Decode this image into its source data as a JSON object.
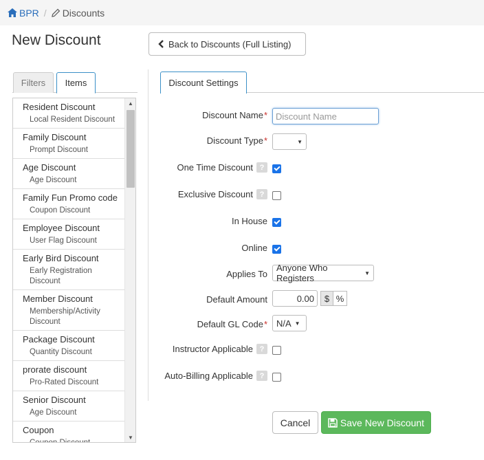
{
  "breadcrumb": {
    "home_label": "BPR",
    "separator": "/",
    "current_label": "Discounts",
    "home_icon": "home-icon",
    "current_icon": "pencil-icon"
  },
  "page": {
    "title": "New Discount",
    "back_button_label": "Back to Discounts (Full Listing)",
    "back_icon": "chevron-left-icon"
  },
  "left_tabs": [
    {
      "label": "Filters",
      "active": false
    },
    {
      "label": "Items",
      "active": true
    }
  ],
  "items": [
    {
      "name": "Resident Discount",
      "type": "Local Resident Discount"
    },
    {
      "name": "Family Discount",
      "type": "Prompt Discount"
    },
    {
      "name": "Age Discount",
      "type": "Age Discount"
    },
    {
      "name": "Family Fun Promo code",
      "type": "Coupon Discount"
    },
    {
      "name": "Employee Discount",
      "type": "User Flag Discount"
    },
    {
      "name": "Early Bird Discount",
      "type": "Early Registration Discount"
    },
    {
      "name": "Member Discount",
      "type": "Membership/Activity Discount"
    },
    {
      "name": "Package Discount",
      "type": "Quantity Discount"
    },
    {
      "name": "prorate discount",
      "type": "Pro-Rated Discount"
    },
    {
      "name": "Senior Discount",
      "type": "Age Discount"
    },
    {
      "name": "Coupon",
      "type": "Coupon Discount"
    }
  ],
  "settings_tab": {
    "label": "Discount Settings"
  },
  "form": {
    "discount_name": {
      "label": "Discount Name",
      "required": "*",
      "placeholder": "Discount Name",
      "value": ""
    },
    "discount_type": {
      "label": "Discount Type",
      "required": "*",
      "value": ""
    },
    "one_time": {
      "label": "One Time Discount",
      "help": "?",
      "checked": true
    },
    "exclusive": {
      "label": "Exclusive Discount",
      "help": "?",
      "checked": false
    },
    "in_house": {
      "label": "In House",
      "checked": true
    },
    "online": {
      "label": "Online",
      "checked": true
    },
    "applies_to": {
      "label": "Applies To",
      "value": "Anyone Who Registers"
    },
    "default_amount": {
      "label": "Default Amount",
      "value": "0.00",
      "unit_dollar": "$",
      "unit_percent": "%",
      "selected_unit": "$"
    },
    "default_gl": {
      "label": "Default GL Code",
      "required": "*",
      "value": "N/A"
    },
    "instructor": {
      "label": "Instructor Applicable",
      "help": "?",
      "checked": false
    },
    "auto_billing": {
      "label": "Auto-Billing Applicable",
      "help": "?",
      "checked": false
    }
  },
  "buttons": {
    "cancel": "Cancel",
    "save": "Save New Discount",
    "save_icon": "floppy-disk-icon"
  },
  "colors": {
    "link": "#2a6ebb",
    "required": "#c9302c",
    "save_bg": "#5cb85c",
    "checkbox_checked": "#1a73e8"
  }
}
